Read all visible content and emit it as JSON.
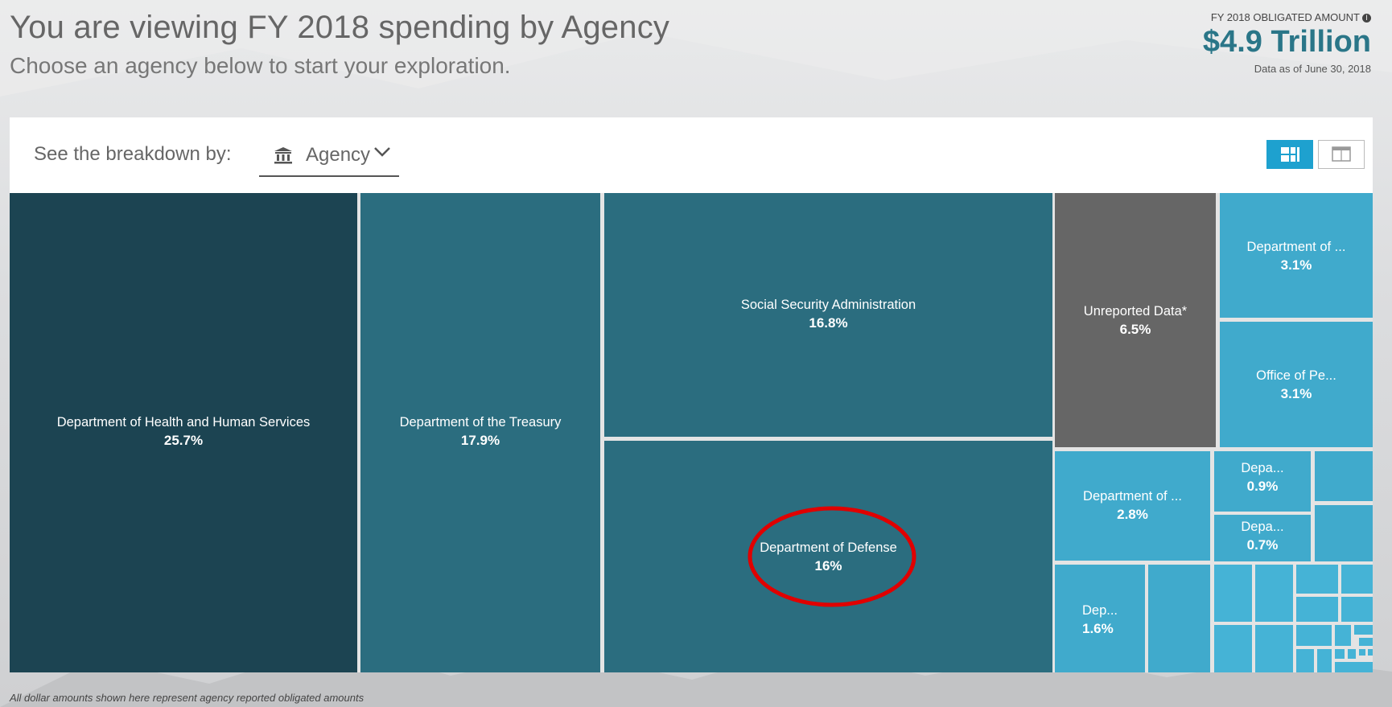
{
  "header": {
    "title": "You are viewing FY 2018 spending by Agency",
    "subtitle": "Choose an agency below to start your exploration."
  },
  "summary": {
    "label": "FY 2018 OBLIGATED AMOUNT",
    "info_icon": "info-icon",
    "amount": "$4.9 Trillion",
    "as_of": "Data as of June 30, 2018"
  },
  "controls": {
    "breakdown_label": "See the breakdown by:",
    "breakdown_value": "Agency",
    "breakdown_icon": "bank-building-icon",
    "view_treemap_icon": "treemap-view-icon",
    "view_table_icon": "table-view-icon"
  },
  "treemap": {
    "tiles": [
      {
        "name": "Department of Health and Human Services",
        "pct": "25.7%"
      },
      {
        "name": "Department of the Treasury",
        "pct": "17.9%"
      },
      {
        "name": "Social Security Administration",
        "pct": "16.8%"
      },
      {
        "name": "Department of Defense",
        "pct": "16%"
      },
      {
        "name": "Unreported Data*",
        "pct": "6.5%"
      },
      {
        "name": "Department of ...",
        "pct": "3.1%"
      },
      {
        "name": "Office of Pe...",
        "pct": "3.1%"
      },
      {
        "name": "Department of ...",
        "pct": "2.8%"
      },
      {
        "name": "Depa...",
        "pct": "0.9%"
      },
      {
        "name": "Depa...",
        "pct": "0.7%"
      },
      {
        "name": "Dep...",
        "pct": "1.6%"
      }
    ],
    "colors": {
      "dark": "#1c4452",
      "mid": "#2b6d7f",
      "gray": "#666666",
      "light": "#40aacc",
      "highlight": "#e00000"
    }
  },
  "footnote": "All dollar amounts shown here represent agency reported obligated amounts"
}
